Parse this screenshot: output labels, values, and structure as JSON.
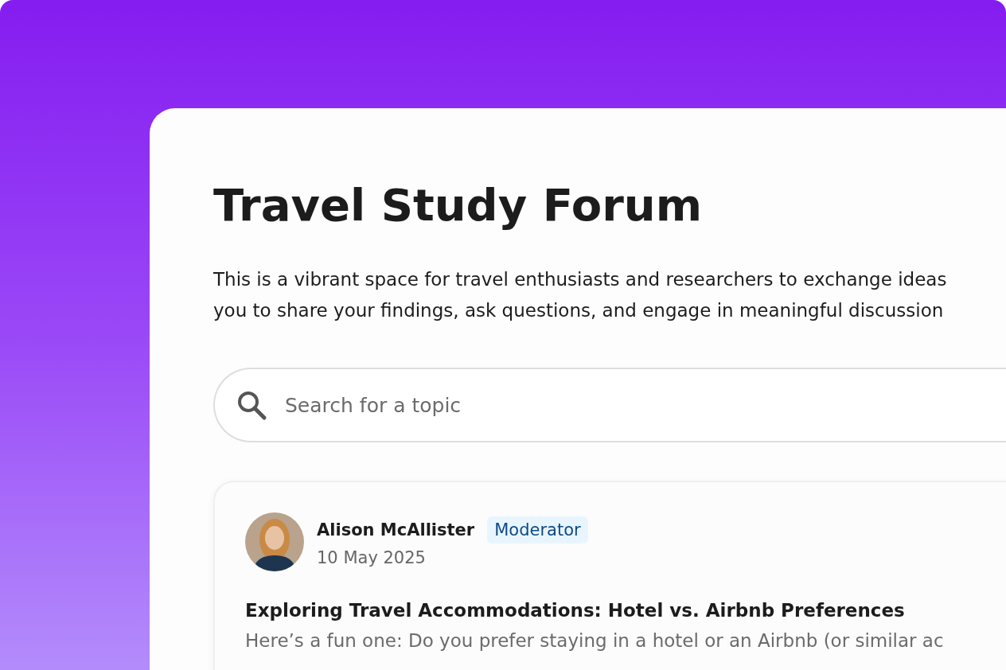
{
  "forum": {
    "title": "Travel Study Forum",
    "description_lines": [
      "This is a vibrant space for travel enthusiasts and researchers to exchange ideas",
      "you to share your findings, ask questions, and engage in meaningful discussion"
    ]
  },
  "search": {
    "placeholder": "Search for a topic"
  },
  "posts": [
    {
      "author": "Alison McAllister",
      "role": "Moderator",
      "date": "10 May 2025",
      "title": "Exploring Travel Accommodations: Hotel vs. Airbnb Preferences",
      "excerpt": "Here’s a fun one: Do you prefer staying in a hotel or an Airbnb (or similar ac"
    }
  ]
}
